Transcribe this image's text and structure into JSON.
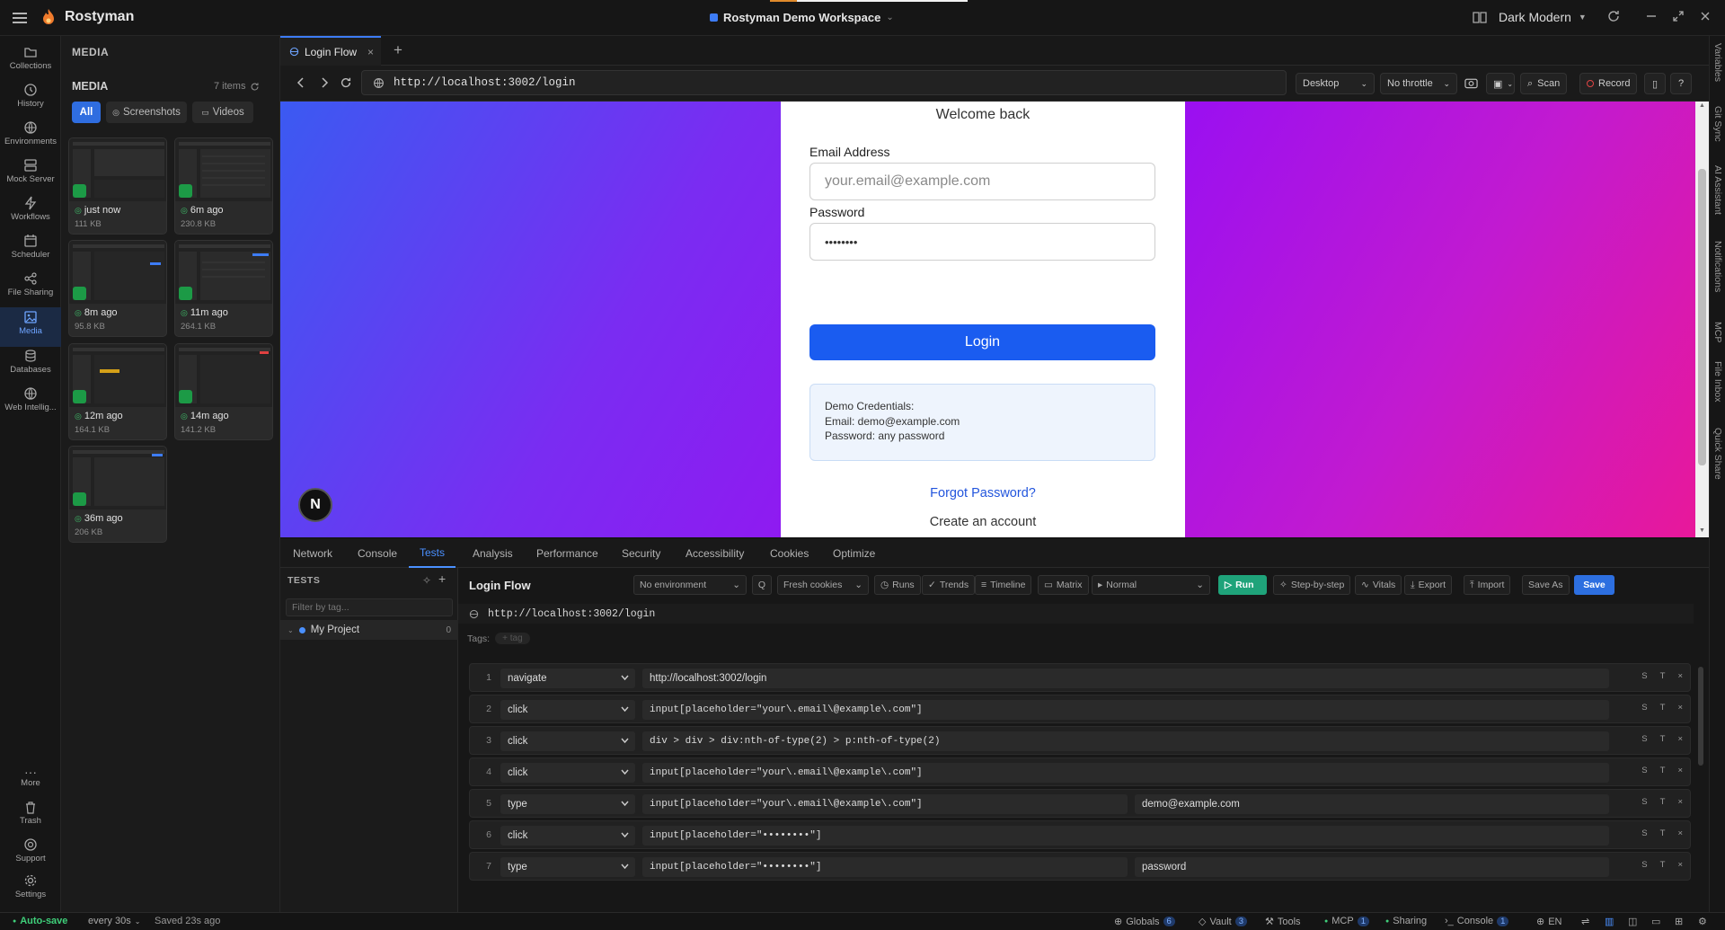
{
  "app": {
    "name": "Rostyman",
    "workspace": "Rostyman Demo Workspace",
    "theme": "Dark Modern"
  },
  "nav": [
    {
      "label": "Collections",
      "icon": "folder-icon"
    },
    {
      "label": "History",
      "icon": "clock-icon"
    },
    {
      "label": "Environments",
      "icon": "globe-icon"
    },
    {
      "label": "Mock Server",
      "icon": "server-icon"
    },
    {
      "label": "Workflows",
      "icon": "bolt-icon"
    },
    {
      "label": "Scheduler",
      "icon": "calendar-icon"
    },
    {
      "label": "File Sharing",
      "icon": "share-icon"
    },
    {
      "label": "Media",
      "icon": "image-icon"
    },
    {
      "label": "Databases",
      "icon": "database-icon"
    },
    {
      "label": "Web Intellig...",
      "icon": "globe-icon"
    }
  ],
  "nav_bottom": [
    {
      "label": "More",
      "icon": "more-icon"
    },
    {
      "label": "Trash",
      "icon": "trash-icon"
    },
    {
      "label": "Support",
      "icon": "support-icon"
    },
    {
      "label": "Settings",
      "icon": "gear-icon"
    }
  ],
  "media": {
    "header": "MEDIA",
    "title": "MEDIA",
    "count": "7 items",
    "filters": [
      "All",
      "Screenshots",
      "Videos"
    ],
    "items": [
      {
        "time": "just now",
        "size": "111 KB"
      },
      {
        "time": "6m ago",
        "size": "230.8 KB"
      },
      {
        "time": "8m ago",
        "size": "95.8 KB"
      },
      {
        "time": "11m ago",
        "size": "264.1 KB"
      },
      {
        "time": "12m ago",
        "size": "164.1 KB"
      },
      {
        "time": "14m ago",
        "size": "141.2 KB"
      },
      {
        "time": "36m ago",
        "size": "206 KB"
      }
    ]
  },
  "tab": {
    "title": "Login Flow",
    "add": "+"
  },
  "browser": {
    "url": "http://localhost:3002/login",
    "device": "Desktop",
    "throttle": "No throttle",
    "scan": "Scan",
    "record": "Record"
  },
  "page": {
    "welcome": "Welcome back",
    "email_label": "Email Address",
    "email_placeholder": "your.email@example.com",
    "password_label": "Password",
    "password_value": "••••••••",
    "login_button": "Login",
    "demo_title": "Demo Credentials:",
    "demo_email": "Email: demo@example.com",
    "demo_password": "Password: any password",
    "forgot": "Forgot Password?",
    "create": "Create an account",
    "next_badge": "N"
  },
  "devtools": {
    "tabs": [
      "Network",
      "Console",
      "Tests",
      "Analysis",
      "Performance",
      "Security",
      "Accessibility",
      "Cookies",
      "Optimize"
    ],
    "active": "Tests"
  },
  "tests": {
    "header": "TESTS",
    "filter_placeholder": "Filter by tag...",
    "project": "My Project",
    "project_count": "0"
  },
  "editor": {
    "title": "Login Flow",
    "environment": "No environment",
    "q": "Q",
    "cookies": "Fresh cookies",
    "runs": "Runs",
    "trends": "Trends",
    "timeline": "Timeline",
    "matrix": "Matrix",
    "mode": "Normal",
    "run": "Run",
    "step_by_step": "Step-by-step",
    "vitals": "Vitals",
    "export": "Export",
    "import": "Import",
    "save_as": "Save As",
    "save": "Save",
    "url": "http://localhost:3002/login",
    "tags_label": "Tags:",
    "tag_placeholder": "+ tag",
    "step_controls": [
      "S",
      "T",
      "×"
    ]
  },
  "steps": [
    {
      "n": "1",
      "action": "navigate",
      "target": "http://localhost:3002/login",
      "value": ""
    },
    {
      "n": "2",
      "action": "click",
      "target": "input[placeholder=\"your\\.email\\@example\\.com\"]",
      "value": ""
    },
    {
      "n": "3",
      "action": "click",
      "target": "div > div > div:nth-of-type(2) > p:nth-of-type(2)",
      "value": ""
    },
    {
      "n": "4",
      "action": "click",
      "target": "input[placeholder=\"your\\.email\\@example\\.com\"]",
      "value": ""
    },
    {
      "n": "5",
      "action": "type",
      "target": "input[placeholder=\"your\\.email\\@example\\.com\"]",
      "value": "demo@example.com"
    },
    {
      "n": "6",
      "action": "click",
      "target": "input[placeholder=\"••••••••\"]",
      "value": ""
    },
    {
      "n": "7",
      "action": "type",
      "target": "input[placeholder=\"••••••••\"]",
      "value": "password"
    }
  ],
  "status": {
    "autosave": "Auto-save",
    "interval": "every 30s",
    "saved": "Saved 23s ago",
    "globals": "Globals",
    "globals_n": "6",
    "vault": "Vault",
    "vault_n": "3",
    "tools": "Tools",
    "mcp": "MCP",
    "mcp_n": "1",
    "sharing": "Sharing",
    "console": "Console",
    "console_n": "1",
    "lang": "EN"
  },
  "rail": [
    "Variables",
    "Git Sync",
    "AI Assistant",
    "Notifications",
    "MCP",
    "File Inbox",
    "Quick Share"
  ],
  "colors": {
    "accent": "#3d7cf5",
    "run": "#1fa37a",
    "login": "#1a5cf0",
    "badge": "#1c9a46"
  }
}
